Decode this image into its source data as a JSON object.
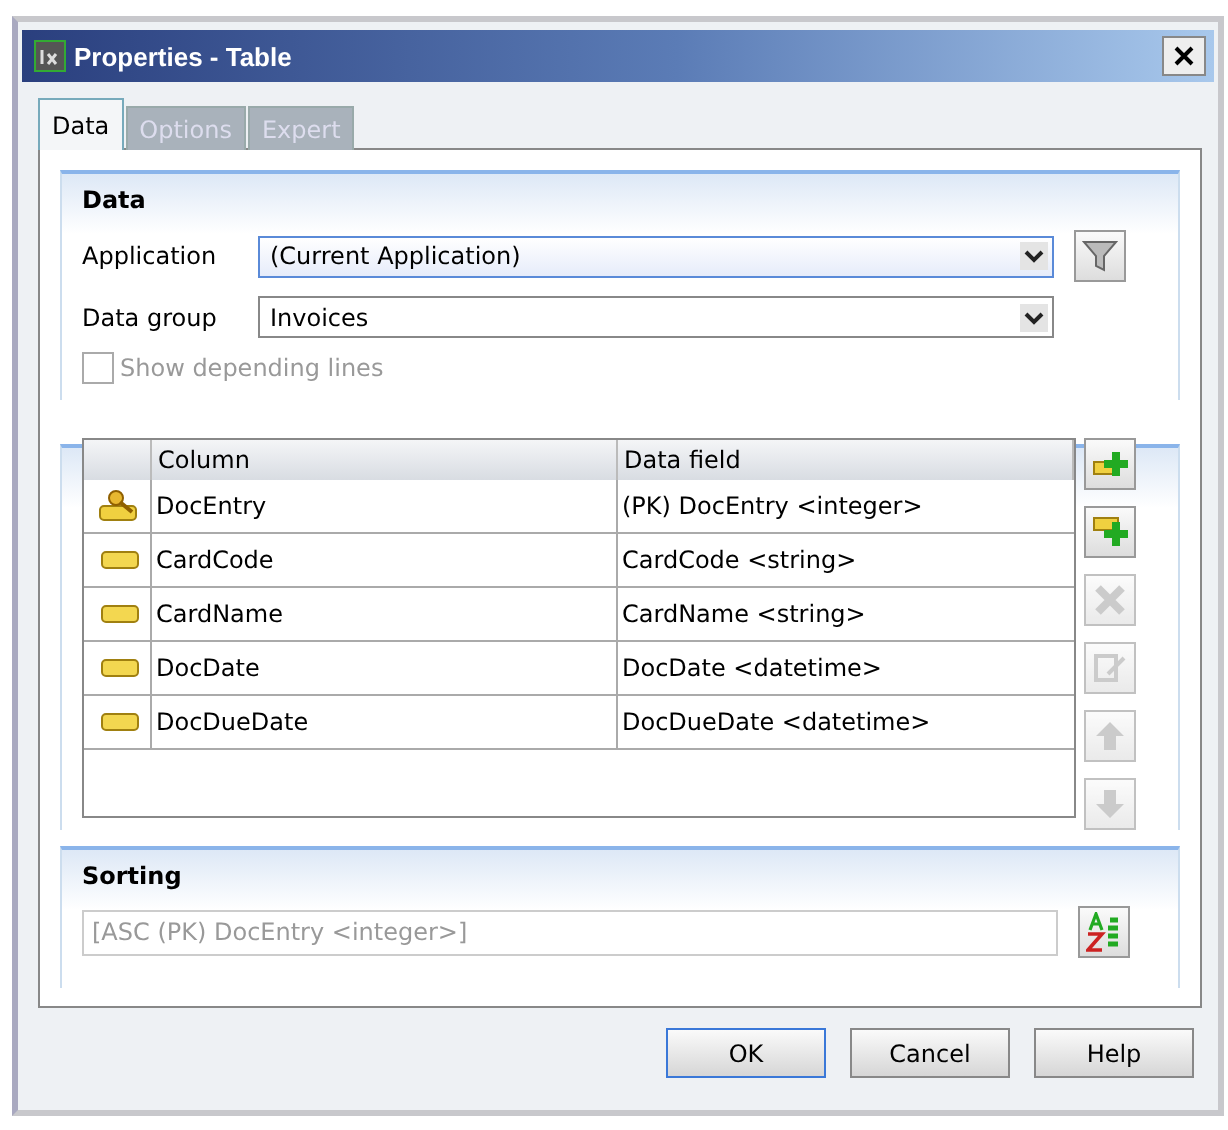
{
  "window": {
    "title": "Properties - Table"
  },
  "tabs": [
    {
      "label": "Data",
      "selected": true
    },
    {
      "label": "Options",
      "selected": false
    },
    {
      "label": "Expert",
      "selected": false
    }
  ],
  "data_section": {
    "title": "Data",
    "application": {
      "label": "Application",
      "value": "(Current Application)",
      "focused": true
    },
    "data_group": {
      "label": "Data group",
      "value": "Invoices",
      "focused": false
    },
    "show_depending_lines": {
      "label": "Show depending lines",
      "checked": false,
      "disabled": true
    }
  },
  "table": {
    "columns": [
      "Column",
      "Data field"
    ],
    "rows": [
      {
        "kind": "key",
        "column": "DocEntry",
        "data_field": "(PK) DocEntry <integer>"
      },
      {
        "kind": "field",
        "column": "CardCode",
        "data_field": "CardCode <string>"
      },
      {
        "kind": "field",
        "column": "CardName",
        "data_field": "CardName <string>"
      },
      {
        "kind": "field",
        "column": "DocDate",
        "data_field": "DocDate <datetime>"
      },
      {
        "kind": "field",
        "column": "DocDueDate",
        "data_field": "DocDueDate <datetime>"
      }
    ],
    "tools": [
      {
        "kind": "add-key",
        "disabled": false
      },
      {
        "kind": "add",
        "disabled": false
      },
      {
        "kind": "delete",
        "disabled": true
      },
      {
        "kind": "edit",
        "disabled": true
      },
      {
        "kind": "up",
        "disabled": true
      },
      {
        "kind": "down",
        "disabled": true
      }
    ]
  },
  "sorting": {
    "title": "Sorting",
    "value": "[ASC (PK) DocEntry <integer>]",
    "disabled": true
  },
  "buttons": [
    {
      "label": "OK",
      "default": true
    },
    {
      "label": "Cancel",
      "default": false
    },
    {
      "label": "Help",
      "default": false
    }
  ]
}
